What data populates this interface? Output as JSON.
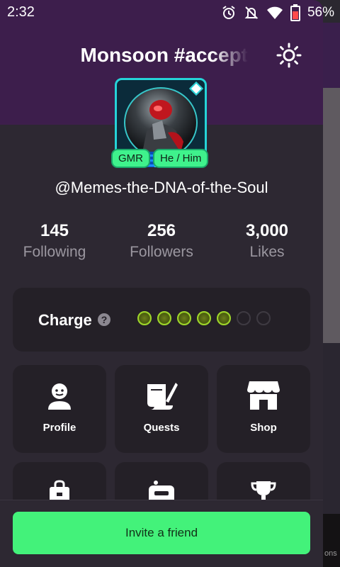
{
  "status_bar": {
    "time": "2:32",
    "icons": [
      "alarm-icon",
      "notifications-off-icon",
      "wifi-icon",
      "battery-icon"
    ],
    "battery": "56%"
  },
  "header": {
    "title": "Monsoon #accept",
    "theme_icon": "sun-icon"
  },
  "profile": {
    "badges": [
      "GMR",
      "He / Him"
    ],
    "username": "@Memes-the-DNA-of-the-Soul"
  },
  "stats": [
    {
      "value": "145",
      "label": "Following"
    },
    {
      "value": "256",
      "label": "Followers"
    },
    {
      "value": "3,000",
      "label": "Likes"
    }
  ],
  "charge": {
    "label": "Charge",
    "filled": 5,
    "total": 7
  },
  "tiles": [
    {
      "label": "Profile",
      "icon": "profile-icon"
    },
    {
      "label": "Quests",
      "icon": "quests-icon"
    },
    {
      "label": "Shop",
      "icon": "shop-icon"
    },
    {
      "label": "",
      "icon": "bag-icon"
    },
    {
      "label": "",
      "icon": "radio-icon"
    },
    {
      "label": "",
      "icon": "trophy-icon"
    }
  ],
  "invite_button": "Invite a friend",
  "background_peek_text": "ons",
  "colors": {
    "header_bg": "#3d1e4c",
    "drawer_bg": "#2d2832",
    "card_bg": "#242027",
    "accent_green": "#43f27a",
    "frame_cyan": "#25d4d8"
  }
}
